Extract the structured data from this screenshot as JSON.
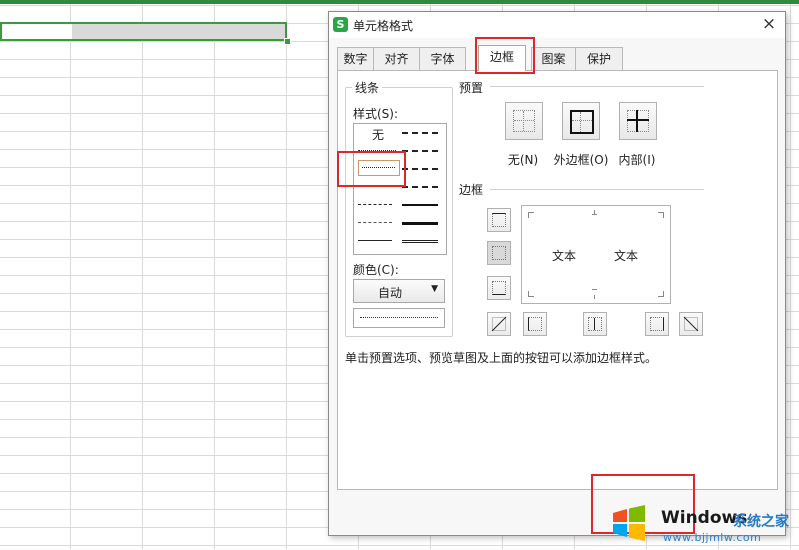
{
  "dialog": {
    "title": "单元格格式",
    "app_icon": "S",
    "close": "×",
    "tabs": [
      {
        "label": "数字"
      },
      {
        "label": "对齐"
      },
      {
        "label": "字体"
      },
      {
        "label": "边框",
        "active": true
      },
      {
        "label": "图案"
      },
      {
        "label": "保护"
      }
    ],
    "line_group": {
      "legend": "线条",
      "style_label": "样式(S):",
      "style_none": "无",
      "color_label": "颜色(C):",
      "color_value": "自动",
      "color_arrow": "▼"
    },
    "preset_group": {
      "legend": "预置",
      "buttons": [
        {
          "label": "无(N)"
        },
        {
          "label": "外边框(O)"
        },
        {
          "label": "内部(I)"
        }
      ]
    },
    "border_group": {
      "legend": "边框",
      "preview_text_left": "文本",
      "preview_text_right": "文本"
    },
    "hint": "单击预置选项、预览草图及上面的按钮可以添加边框样式。"
  },
  "watermark": {
    "brand": "Windows",
    "cn": "系统之家",
    "url": "www.bjjmlw.com"
  },
  "colors": {
    "accent_green": "#29a745",
    "highlight_red": "#e0262b",
    "selection_green": "#3c9a3c"
  }
}
